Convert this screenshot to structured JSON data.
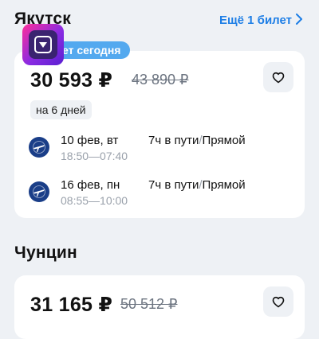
{
  "sections": [
    {
      "city": "Якутск",
      "more_link": "Ещё 1 билет",
      "badge": "ет сегодня",
      "price": "30 593 ₽",
      "old_price": "43 890 ₽",
      "duration_tag": "на 6 дней",
      "segments": [
        {
          "date": "10 фев, вт",
          "depart": "18:50",
          "arrive": "07:40",
          "travel_time": "7ч в пути",
          "type": "Прямой"
        },
        {
          "date": "16 фев, пн",
          "depart": "08:55",
          "arrive": "10:00",
          "travel_time": "7ч в пути",
          "type": "Прямой"
        }
      ]
    },
    {
      "city": "Чунцин",
      "price": "31 165 ₽",
      "old_price": "50 512 ₽"
    }
  ],
  "separators": {
    "time": "—",
    "type": "/"
  },
  "icons": {
    "favorite": "heart-outline-icon",
    "more_chevron": "chevron-right-icon",
    "airline": "airline-logo-icon",
    "app": "app-icon"
  },
  "colors": {
    "accent": "#1d7ee6",
    "badge": "#53a9ef",
    "background": "#eef1f5",
    "muted": "#9aa1ab",
    "airline": "#1a3e88"
  }
}
